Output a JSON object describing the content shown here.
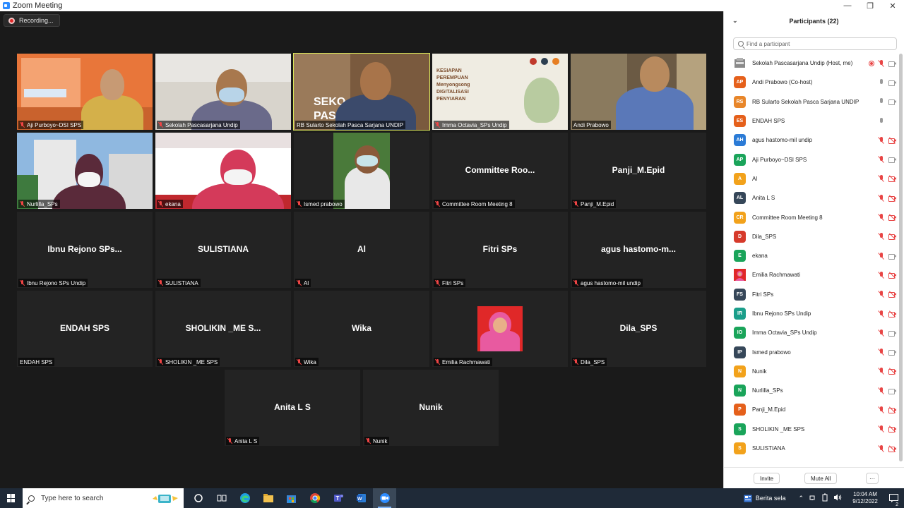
{
  "window": {
    "title": "Zoom Meeting",
    "controls": [
      "—",
      "❐",
      "✕"
    ]
  },
  "recording": {
    "label": "Recording..."
  },
  "tiles": [
    {
      "name": "Aji Purboyo~DSI SPS",
      "video": "orange-slide",
      "muted": true
    },
    {
      "name": "Sekolah Pascasarjana Undip",
      "video": "mask-man",
      "muted": true
    },
    {
      "name": "RB Sularto Sekolah Pasca Sarjana UNDIP",
      "video": "speaker",
      "muted": false,
      "active": true
    },
    {
      "name": "Imma Octavia_SPs Undip",
      "video": "poster",
      "muted": true
    },
    {
      "name": "Andi Prabowo",
      "video": "office",
      "muted": false
    },
    {
      "name": "Nurlilla_SPs",
      "video": "building",
      "muted": true
    },
    {
      "name": "ekana",
      "video": "banner",
      "muted": true
    },
    {
      "name": "Ismed prabowo",
      "video": "outdoor",
      "muted": true
    },
    {
      "name": "Committee Room Meeting 8",
      "big": "Committee  Roo...",
      "muted": true
    },
    {
      "name": "Panji_M.Epid",
      "big": "Panji_M.Epid",
      "muted": true
    },
    {
      "name": "Ibnu Rejono SPs Undip",
      "big": "Ibnu  Rejono  SPs...",
      "muted": true
    },
    {
      "name": "SULISTIANA",
      "big": "SULISTIANA",
      "muted": true
    },
    {
      "name": "Al",
      "big": "Al",
      "muted": true
    },
    {
      "name": "Fitri SPs",
      "big": "Fitri SPs",
      "muted": true
    },
    {
      "name": "agus hastomo-mil undip",
      "big": "agus  hastomo-m...",
      "muted": true
    },
    {
      "name": "ENDAH SPS",
      "big": "ENDAH SPS",
      "muted": false
    },
    {
      "name": "SHOLIKIN _ME SPS",
      "big": "SHOLIKIN  _ME  S...",
      "muted": true
    },
    {
      "name": "Wika",
      "big": "Wika",
      "muted": true
    },
    {
      "name": "Emilia Rachmawati",
      "video": "photo",
      "muted": true
    },
    {
      "name": "Dila_SPS",
      "big": "Dila_SPS",
      "muted": true
    },
    {
      "name": "Anita L S",
      "big": "Anita L S",
      "muted": true
    },
    {
      "name": "Nunik",
      "big": "Nunik",
      "muted": true
    }
  ],
  "panel": {
    "title": "Participants (22)",
    "search_placeholder": "Find a participant",
    "participants": [
      {
        "name": "Sekolah Pascasarjana Undip (Host, me)",
        "initials": "",
        "color": "#6b6b6b",
        "mic": "off",
        "cam": "on",
        "rec": true
      },
      {
        "name": "Andi Prabowo (Co-host)",
        "initials": "AP",
        "color": "#e5601b",
        "mic": "on",
        "cam": "on"
      },
      {
        "name": "RB Sularto Sekolah Pasca Sarjana UNDIP",
        "initials": "RS",
        "color": "#e8862a",
        "mic": "on",
        "cam": "on"
      },
      {
        "name": "ENDAH SPS",
        "initials": "ES",
        "color": "#e5601b",
        "mic": "on",
        "cam": "none"
      },
      {
        "name": "agus hastomo-mil undip",
        "initials": "AH",
        "color": "#2b7bd6",
        "mic": "off",
        "cam": "off"
      },
      {
        "name": "Aji Purboyo~DSI SPS",
        "initials": "AP",
        "color": "#1aa45a",
        "mic": "off",
        "cam": "on"
      },
      {
        "name": "Al",
        "initials": "A",
        "color": "#f2a21b",
        "mic": "off",
        "cam": "off"
      },
      {
        "name": "Anita L S",
        "initials": "AL",
        "color": "#364759",
        "mic": "off",
        "cam": "off"
      },
      {
        "name": "Committee Room Meeting 8",
        "initials": "CR",
        "color": "#f2a21b",
        "mic": "off",
        "cam": "off"
      },
      {
        "name": "Dila_SPS",
        "initials": "D",
        "color": "#d63a2b",
        "mic": "off",
        "cam": "off"
      },
      {
        "name": "ekana",
        "initials": "E",
        "color": "#1aa45a",
        "mic": "off",
        "cam": "on"
      },
      {
        "name": "Emilia Rachmawati",
        "initials": "",
        "color": "#d94a8a",
        "mic": "off",
        "cam": "off"
      },
      {
        "name": "Fitri SPs",
        "initials": "FS",
        "color": "#364759",
        "mic": "off",
        "cam": "off"
      },
      {
        "name": "Ibnu Rejono SPs Undip",
        "initials": "IR",
        "color": "#1a9e8a",
        "mic": "off",
        "cam": "off"
      },
      {
        "name": "Imma Octavia_SPs Undip",
        "initials": "IO",
        "color": "#1aa45a",
        "mic": "off",
        "cam": "on"
      },
      {
        "name": "Ismed prabowo",
        "initials": "IP",
        "color": "#364759",
        "mic": "off",
        "cam": "on"
      },
      {
        "name": "Nunik",
        "initials": "N",
        "color": "#f2a21b",
        "mic": "off",
        "cam": "off"
      },
      {
        "name": "Nurlilla_SPs",
        "initials": "N",
        "color": "#1aa45a",
        "mic": "off",
        "cam": "on"
      },
      {
        "name": "Panji_M.Epid",
        "initials": "P",
        "color": "#e5601b",
        "mic": "off",
        "cam": "off"
      },
      {
        "name": "SHOLIKIN _ME SPS",
        "initials": "S",
        "color": "#1aa45a",
        "mic": "off",
        "cam": "off"
      },
      {
        "name": "SULISTIANA",
        "initials": "S",
        "color": "#f2a21b",
        "mic": "off",
        "cam": "off"
      }
    ],
    "invite_label": "Invite",
    "mute_all_label": "Mute All",
    "more_label": "···"
  },
  "taskbar": {
    "search_placeholder": "Type here to search",
    "news_label": "Berita sela",
    "time": "10:04 AM",
    "date": "9/12/2022",
    "notif_count": "2"
  }
}
